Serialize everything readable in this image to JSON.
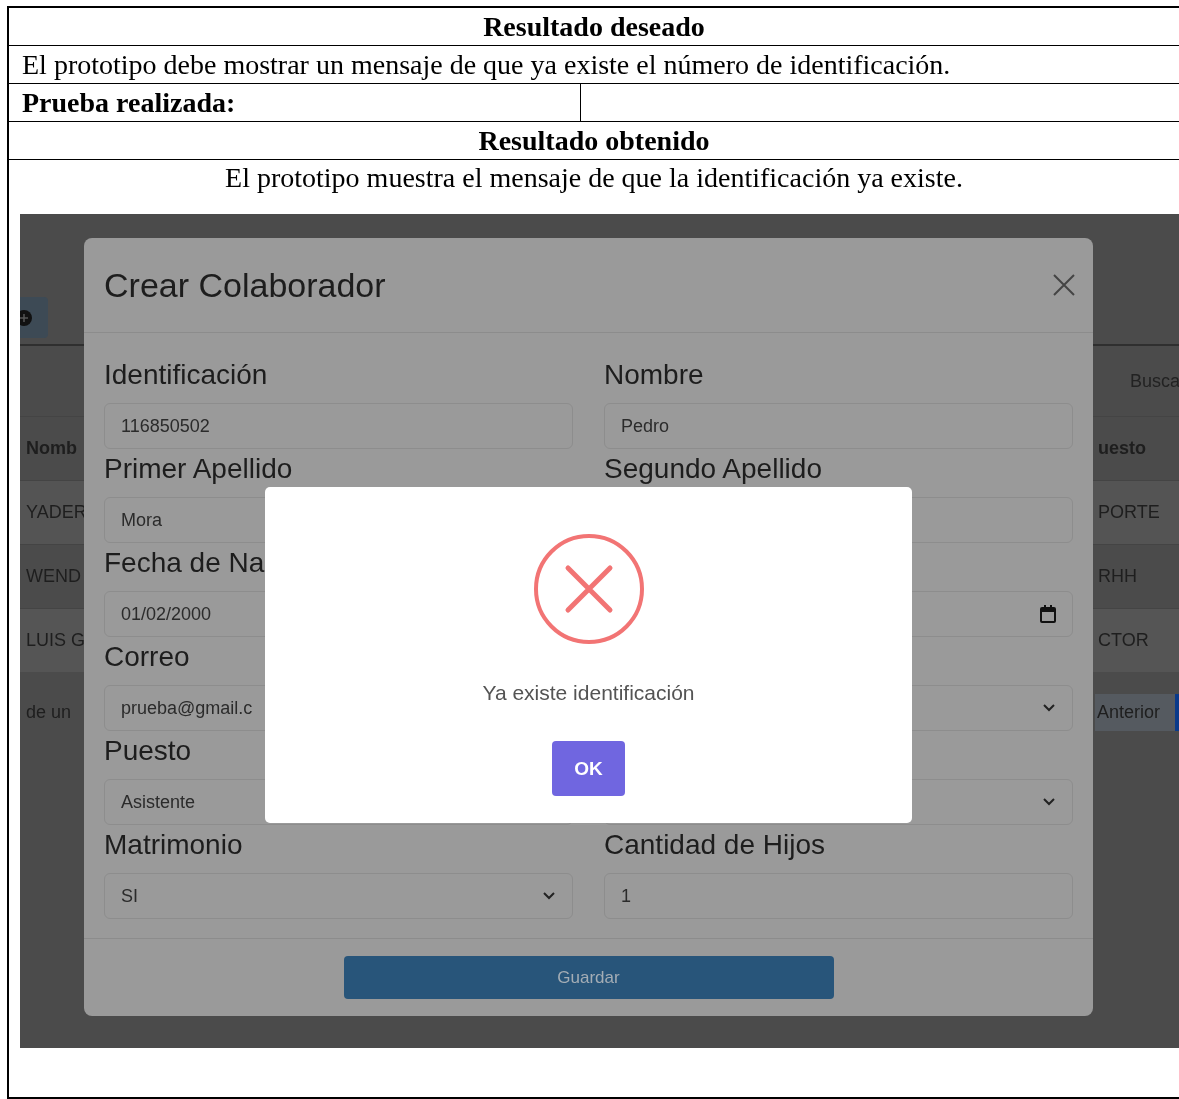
{
  "document": {
    "desired_header": "Resultado deseado",
    "desired_text": "El prototipo debe mostrar un mensaje de que ya existe el número de identificación.",
    "test_label": "Prueba realizada:",
    "obtained_header": "Resultado obtenido",
    "obtained_text": "El prototipo muestra el mensaje de que la identificación ya existe."
  },
  "screenshot": {
    "background": {
      "search_label": "Busca",
      "table": {
        "header": [
          "Nomb",
          "uesto"
        ],
        "rows": [
          [
            "YADER",
            "PORTE"
          ],
          [
            "WEND",
            "RHH"
          ],
          [
            "LUIS G",
            "CTOR"
          ]
        ]
      },
      "footer_text": "de un",
      "prev_button": "Anterior"
    },
    "modal": {
      "title": "Crear Colaborador",
      "fields": [
        {
          "label": "Identificación",
          "value": "116850502",
          "kind": "text"
        },
        {
          "label": "Nombre",
          "value": "Pedro",
          "kind": "text"
        },
        {
          "label": "Primer Apellido",
          "value": "Mora",
          "kind": "text"
        },
        {
          "label": "Segundo Apellido",
          "kind": "text"
        },
        {
          "label": "Fecha de Na",
          "value": "01/02/2000",
          "kind": "text"
        },
        {
          "kind": "date"
        },
        {
          "label": "Correo",
          "value": "prueba@gmail.c",
          "kind": "text"
        },
        {
          "kind": "select"
        },
        {
          "label": "Puesto",
          "value": "Asistente",
          "kind": "text"
        },
        {
          "kind": "select"
        },
        {
          "label": "Matrimonio",
          "value": "SI",
          "kind": "select"
        },
        {
          "label": "Cantidad de Hijos",
          "value": "1",
          "kind": "text"
        }
      ],
      "save_button": "Guardar"
    },
    "alert": {
      "message": "Ya existe identificación",
      "button": "OK"
    }
  }
}
